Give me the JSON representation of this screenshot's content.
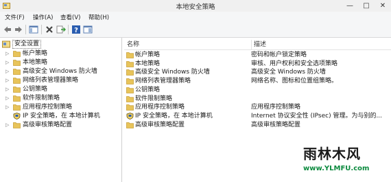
{
  "window": {
    "title": "本地安全策略",
    "minimize": "—",
    "maximize": "□",
    "close": "✕"
  },
  "menu": [
    "文件(F)",
    "操作(A)",
    "查看(V)",
    "帮助(H)"
  ],
  "tree": {
    "root": "安全设置",
    "items": [
      {
        "label": "帐户策略",
        "icon": "folder-icon"
      },
      {
        "label": "本地策略",
        "icon": "folder-icon"
      },
      {
        "label": "高级安全 Windows 防火墙",
        "icon": "folder-icon"
      },
      {
        "label": "网络列表管理器策略",
        "icon": "folder-icon"
      },
      {
        "label": "公钥策略",
        "icon": "folder-icon"
      },
      {
        "label": "软件限制策略",
        "icon": "folder-icon"
      },
      {
        "label": "应用程序控制策略",
        "icon": "folder-icon"
      },
      {
        "label": "IP 安全策略，在 本地计算机",
        "icon": "ipsec-icon"
      },
      {
        "label": "高级审核策略配置",
        "icon": "folder-icon"
      }
    ]
  },
  "list": {
    "columns": [
      "名称",
      "描述"
    ],
    "rows": [
      {
        "name": "帐户策略",
        "desc": "密码和帐户锁定策略",
        "icon": "folder-icon"
      },
      {
        "name": "本地策略",
        "desc": "审核、用户权利和安全选项策略",
        "icon": "folder-icon"
      },
      {
        "name": "高级安全 Windows 防火墙",
        "desc": "高级安全 Windows 防火墙",
        "icon": "folder-icon"
      },
      {
        "name": "网络列表管理器策略",
        "desc": "网络名称、图标和位置组策略。",
        "icon": "folder-icon"
      },
      {
        "name": "公钥策略",
        "desc": "",
        "icon": "folder-icon"
      },
      {
        "name": "软件限制策略",
        "desc": "",
        "icon": "folder-icon"
      },
      {
        "name": "应用程序控制策略",
        "desc": "应用程序控制策略",
        "icon": "folder-icon"
      },
      {
        "name": "IP 安全策略，在 本地计算机",
        "desc": "Internet 协议安全性 (IPsec) 管理。为与别的...",
        "icon": "ipsec-icon"
      },
      {
        "name": "高级审核策略配置",
        "desc": "高级审核策略配置",
        "icon": "folder-icon"
      }
    ]
  },
  "watermark": {
    "title": "雨林木风",
    "url": "www.YLMFU.com"
  },
  "colors": {
    "folder": "#e8c45a",
    "folder_dark": "#c9a13a",
    "accent": "#2a6fc9",
    "watermark_green": "#0b8a3e"
  }
}
